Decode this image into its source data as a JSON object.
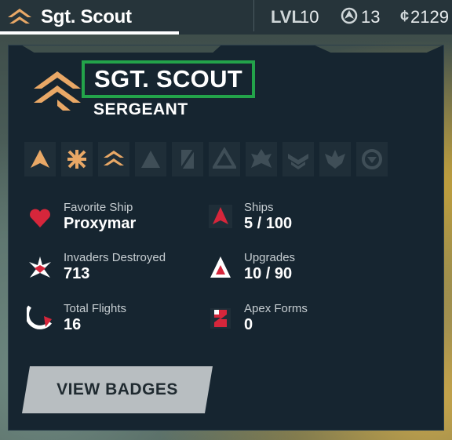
{
  "header": {
    "player_name": "Sgt. Scout",
    "level_label": "LVL",
    "level_value": "10",
    "fleet_value": "13",
    "credits_symbol": "¢",
    "credits_value": "2129"
  },
  "profile": {
    "title": "SGT. SCOUT",
    "rank": "SERGEANT",
    "rank_badges": [
      {
        "icon": "rank-1-icon",
        "unlocked": true
      },
      {
        "icon": "rank-2-icon",
        "unlocked": true
      },
      {
        "icon": "rank-3-icon",
        "unlocked": true
      },
      {
        "icon": "rank-4-icon",
        "unlocked": false
      },
      {
        "icon": "rank-5-icon",
        "unlocked": false
      },
      {
        "icon": "rank-6-icon",
        "unlocked": false
      },
      {
        "icon": "rank-7-icon",
        "unlocked": false
      },
      {
        "icon": "rank-8-icon",
        "unlocked": false
      },
      {
        "icon": "rank-9-icon",
        "unlocked": false
      },
      {
        "icon": "rank-10-icon",
        "unlocked": false
      }
    ]
  },
  "stats": {
    "favorite_ship": {
      "label": "Favorite Ship",
      "value": "Proxymar",
      "icon": "heart-icon"
    },
    "ships": {
      "label": "Ships",
      "value": "5 / 100",
      "icon": "ship-icon"
    },
    "invaders": {
      "label": "Invaders Destroyed",
      "value": "713",
      "icon": "explosion-icon"
    },
    "upgrades": {
      "label": "Upgrades",
      "value": "10 / 90",
      "icon": "upgrade-icon"
    },
    "flights": {
      "label": "Total Flights",
      "value": "16",
      "icon": "flight-arc-icon"
    },
    "apex": {
      "label": "Apex Forms",
      "value": "0",
      "icon": "apex-icon"
    }
  },
  "actions": {
    "view_badges": "VIEW BADGES"
  },
  "colors": {
    "accent_orange": "#e9a866",
    "accent_red": "#d6263b",
    "highlight_green": "#23a34a",
    "panel_bg": "#162530"
  }
}
